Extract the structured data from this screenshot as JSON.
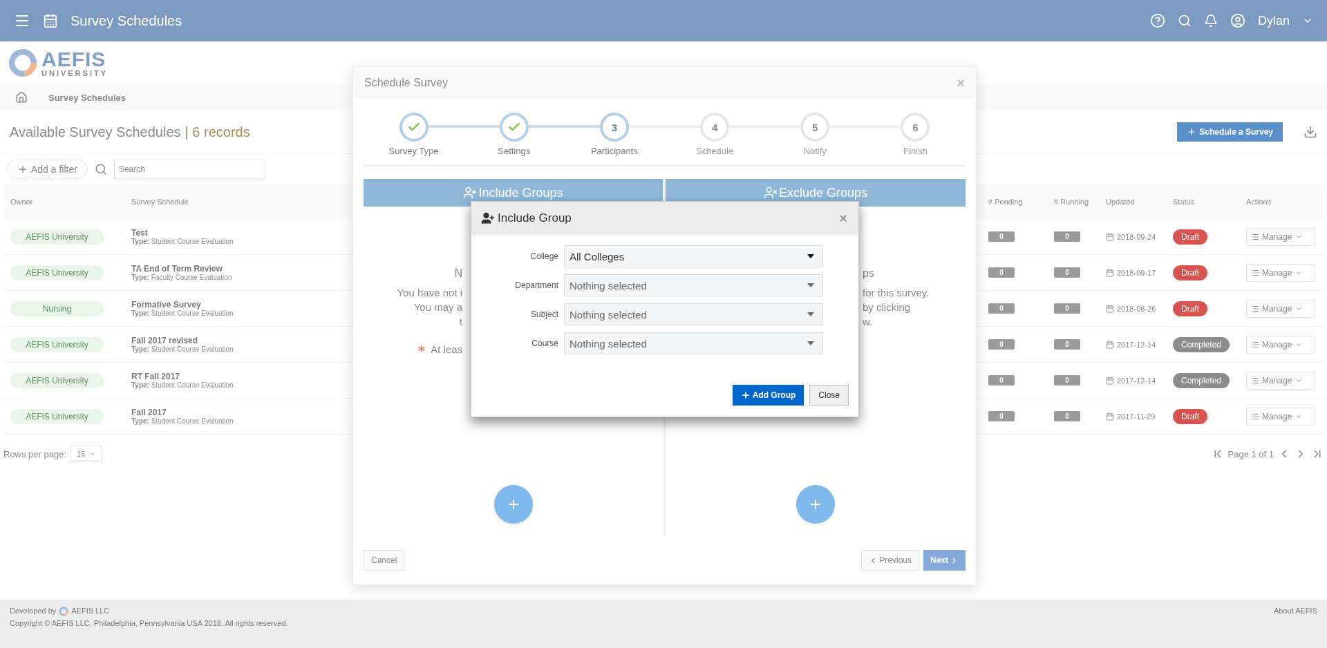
{
  "topbar": {
    "title": "Survey Schedules",
    "user": "Dylan"
  },
  "logo": {
    "name": "AEFIS",
    "subtitle": "UNIVERSITY"
  },
  "breadcrumb": [
    "Survey Schedules"
  ],
  "page": {
    "title": "Available Survey Schedules",
    "count": "| 6 records",
    "action": "Schedule a Survey",
    "filter": "Add a filter",
    "search_placeholder": "Search"
  },
  "table": {
    "columns": [
      "Owner",
      "Survey Schedule",
      "# Pending",
      "# Running",
      "Updated",
      "Status",
      "Actions"
    ],
    "rows": [
      {
        "owner": "AEFIS University",
        "title": "Test",
        "type_label": "Type:",
        "type": "Student Course Evaluation",
        "pending": "0",
        "running": "0",
        "updated": "2018-09-24",
        "status": "Draft",
        "kind": "draft",
        "action": "Manage"
      },
      {
        "owner": "AEFIS University",
        "title": "TA End of Term Review",
        "type_label": "Type:",
        "type": "Faculty Course Evaluation",
        "pending": "0",
        "running": "0",
        "updated": "2018-09-17",
        "status": "Draft",
        "kind": "draft",
        "action": "Manage"
      },
      {
        "owner": "Nursing",
        "title": "Formative Survey",
        "type_label": "Type:",
        "type": "Student Course Evaluation",
        "pending": "0",
        "running": "0",
        "updated": "2018-08-26",
        "status": "Draft",
        "kind": "draft",
        "action": "Manage"
      },
      {
        "owner": "AEFIS University",
        "title": "Fall 2017 revised",
        "type_label": "Type:",
        "type": "Student Course Evaluation",
        "pending": "0",
        "running": "0",
        "updated": "2017-12-14",
        "status": "Completed",
        "kind": "completed",
        "action": "Manage"
      },
      {
        "owner": "AEFIS University",
        "title": "RT Fall 2017",
        "type_label": "Type:",
        "type": "Student Course Evaluation",
        "pending": "0",
        "running": "0",
        "updated": "2017-12-14",
        "status": "Completed",
        "kind": "completed",
        "action": "Manage"
      },
      {
        "owner": "AEFIS University",
        "title": "Fall 2017",
        "type_label": "Type:",
        "type": "Student Course Evaluation",
        "pending": "0",
        "running": "0",
        "updated": "2017-11-29",
        "status": "Draft",
        "kind": "draft",
        "action": "Manage"
      }
    ]
  },
  "pagination": {
    "rows_label": "Rows per page:",
    "rows_value": "15",
    "page": "Page 1 of 1"
  },
  "footer": {
    "developed": "Developed by",
    "company": "AEFIS LLC",
    "copyright": "Copyright © AEFIS LLC, Philadelphia, Pennsylvania USA 2018. All rights reserved.",
    "about": "About AEFIS"
  },
  "wizard": {
    "title": "Schedule Survey",
    "close": "×",
    "steps": [
      {
        "label": "Survey Type",
        "done": true,
        "current": false
      },
      {
        "label": "Settings",
        "done": true,
        "current": false
      },
      {
        "number": "3",
        "label": "Participants",
        "done": false,
        "current": true
      },
      {
        "number": "4",
        "label": "Schedule",
        "done": false,
        "current": false
      },
      {
        "number": "5",
        "label": "Notify",
        "done": false,
        "current": false
      },
      {
        "number": "6",
        "label": "Finish",
        "done": false,
        "current": false
      }
    ],
    "panels": [
      {
        "kind": "include",
        "title": "Include Groups",
        "heading": "N",
        "lines": [
          "You have not i",
          "You may a",
          "t"
        ],
        "note": "At leas"
      },
      {
        "kind": "exclude",
        "title": "Exclude Groups",
        "heading": "ps",
        "lines": [
          "for this survey.",
          "by clicking",
          "w."
        ]
      }
    ],
    "buttons": {
      "cancel": "Cancel",
      "previous": "Previous",
      "next": "Next"
    }
  },
  "dialog": {
    "title": "Include Group",
    "close": "×",
    "fields": [
      {
        "label": "College",
        "value": "All Colleges"
      },
      {
        "label": "Department",
        "placeholder": "Nothing selected"
      },
      {
        "label": "Subject",
        "placeholder": "Nothing selected"
      },
      {
        "label": "Course",
        "placeholder": "Nothing selected"
      }
    ],
    "primary": "Add Group",
    "secondary": "Close"
  }
}
